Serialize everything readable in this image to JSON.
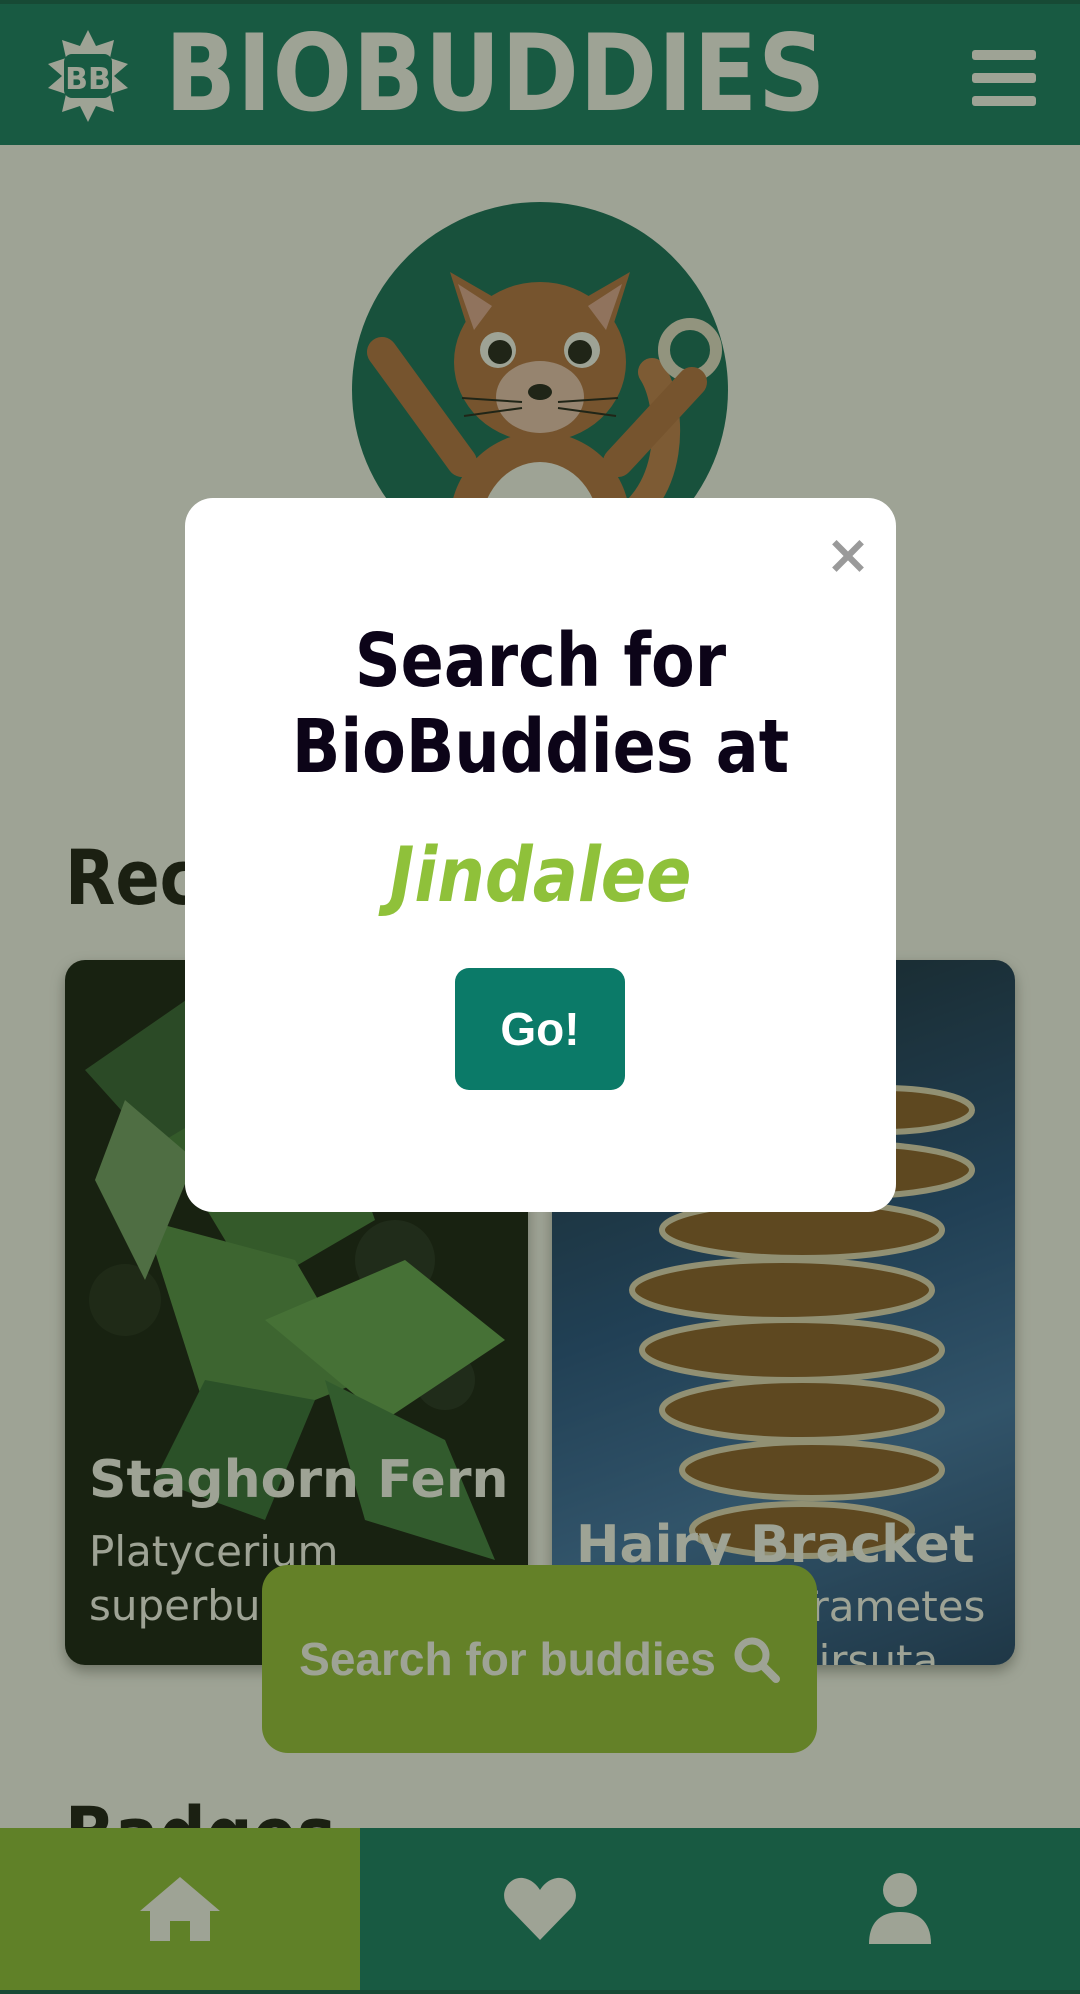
{
  "header": {
    "brand": "BIOBUDDIES",
    "logo_text": "BB",
    "logo_icon": "snowflake-badge-icon",
    "menu_icon": "hamburger-menu-icon"
  },
  "main": {
    "recent_heading": "Recently",
    "cards": [
      {
        "name": "Staghorn Fern",
        "scientific": "Platycerium superbum"
      },
      {
        "name": "Hairy Bracket",
        "scientific": "Trametes hirsuta"
      }
    ],
    "badges_heading": "Badges"
  },
  "search_button": {
    "label": "Search for buddies",
    "icon": "magnifier-search-icon"
  },
  "modal": {
    "close_label": "×",
    "title_line1": "Search for",
    "title_line2": "BioBuddies at",
    "place": "Jindalee",
    "go_label": "Go!"
  },
  "bottom_nav": {
    "items": [
      {
        "icon": "home-icon",
        "active": true
      },
      {
        "icon": "heart-icon",
        "active": false
      },
      {
        "icon": "user-icon",
        "active": false
      }
    ]
  },
  "colors": {
    "brand_teal": "#0b7a68",
    "accent_green": "#8fc13a",
    "overlay": "rgba(40,50,20,0.45)"
  }
}
